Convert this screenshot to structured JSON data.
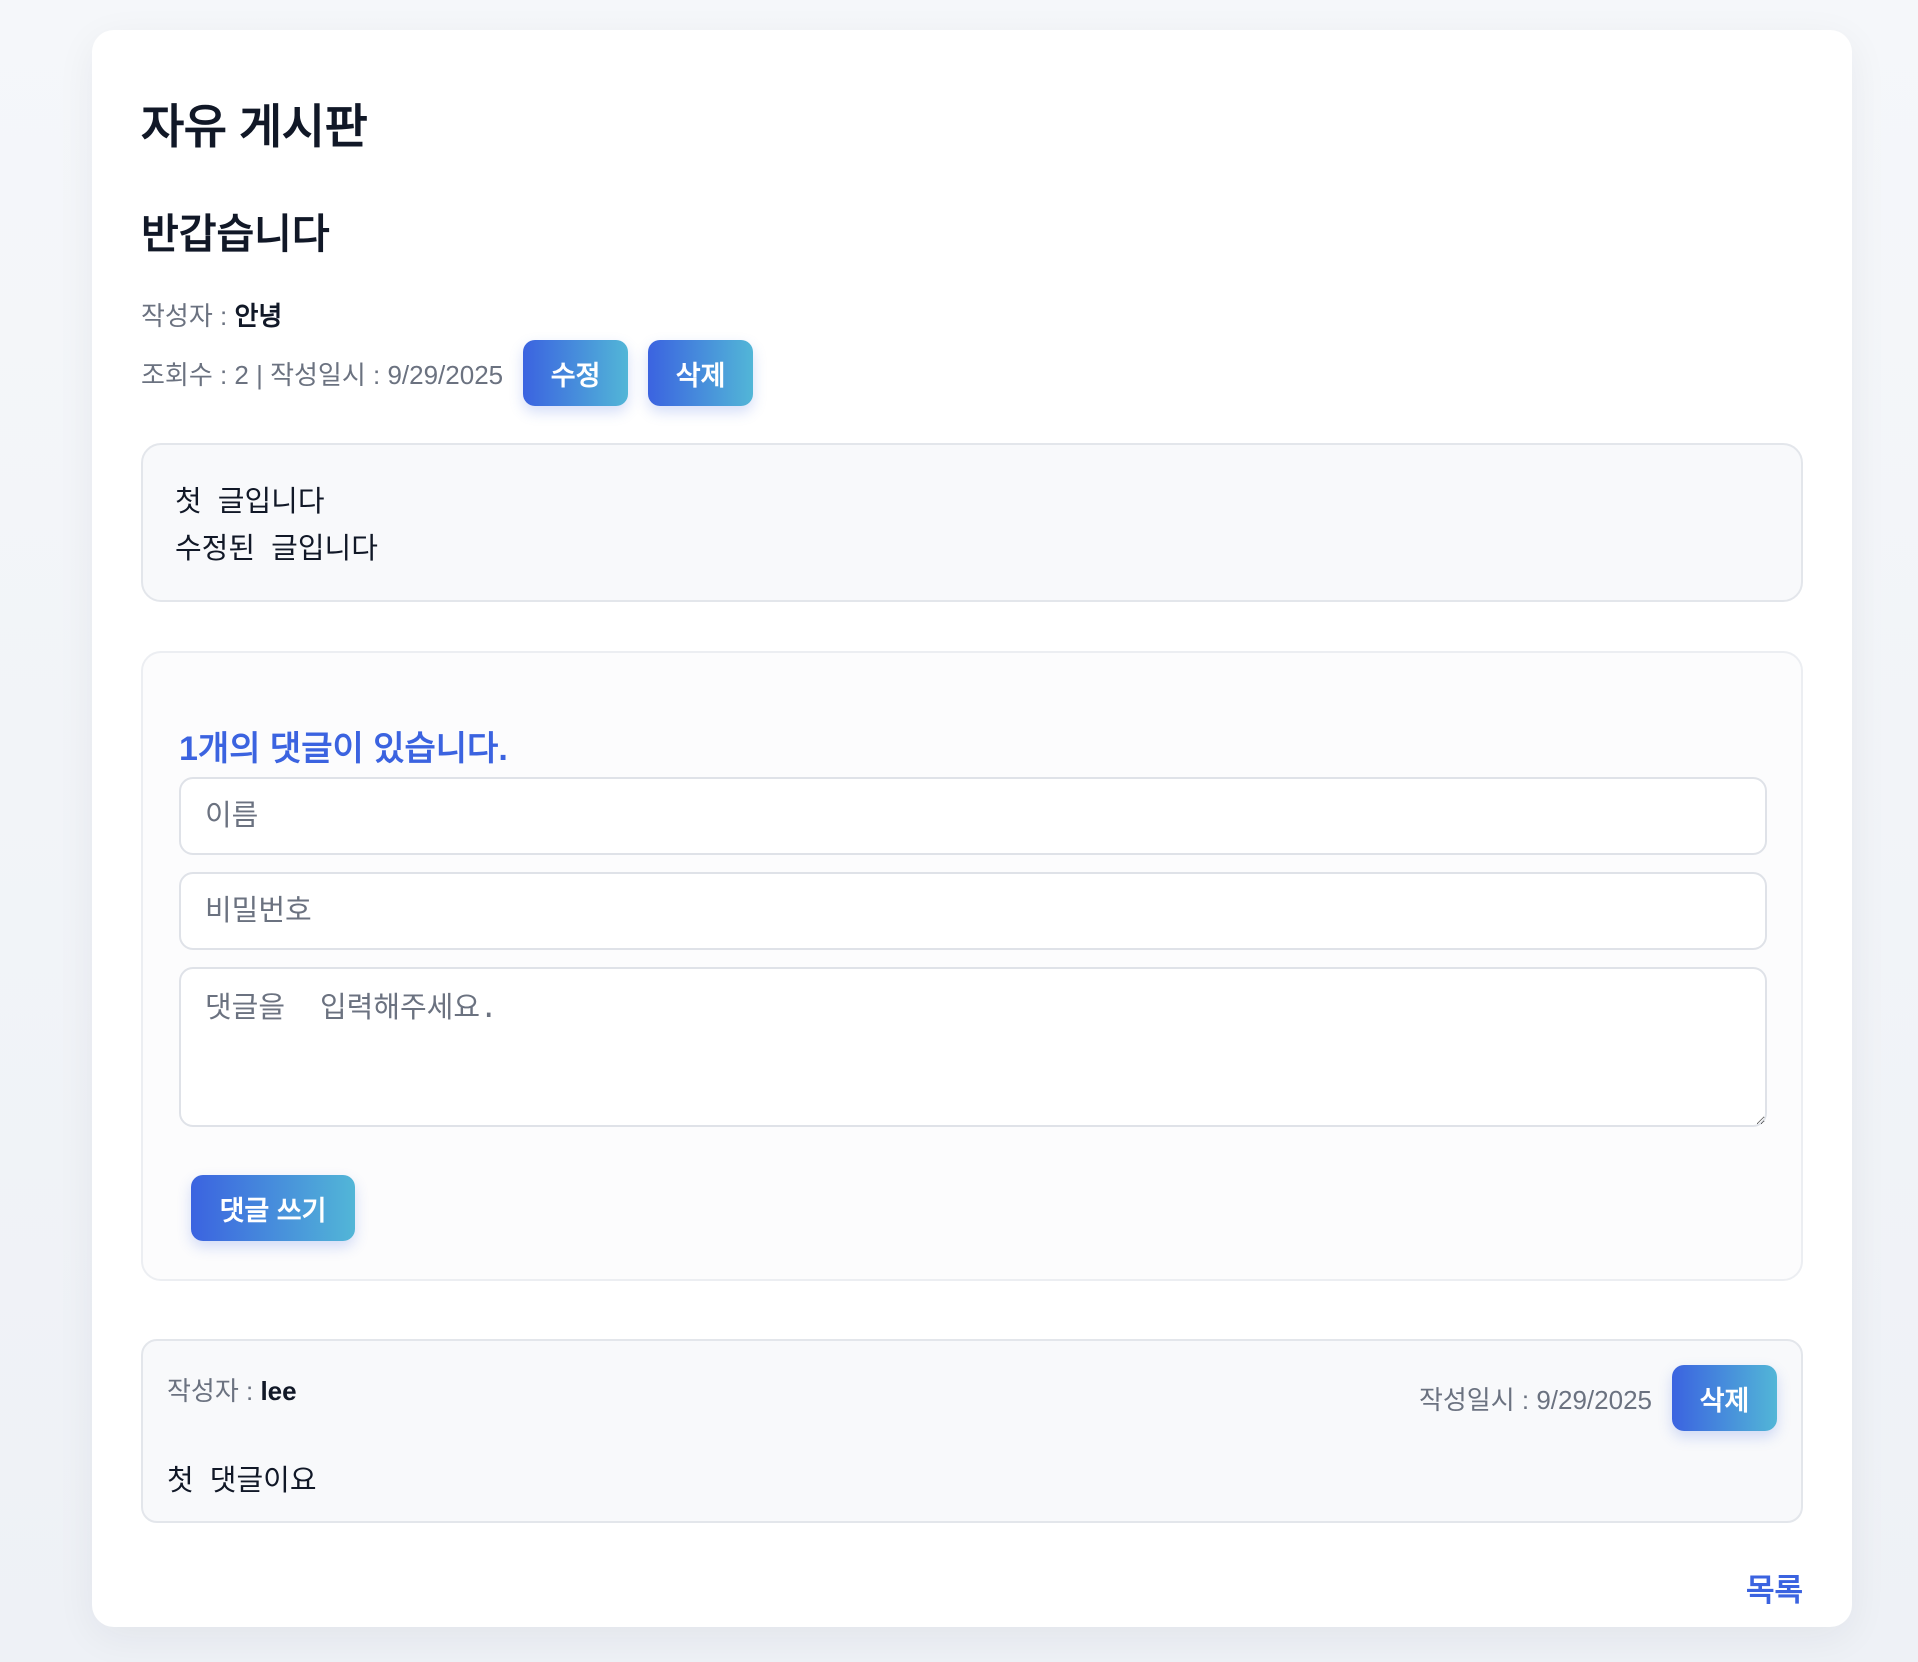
{
  "board": {
    "title": "자유 게시판"
  },
  "post": {
    "title": "반갑습니다",
    "author_label": "작성자 : ",
    "author": "안녕",
    "meta": "조회수 : 2 | 작성일시 : 9/29/2025",
    "edit_label": "수정",
    "delete_label": "삭제",
    "body_lines": [
      "첫  글입니다",
      "수정된  글입니다"
    ]
  },
  "comment_form": {
    "count_text": "1개의 댓글이 있습니다.",
    "name_placeholder": "이름",
    "password_placeholder": "비밀번호",
    "comment_placeholder": "댓글을  입력해주세요.",
    "submit_label": "댓글 쓰기"
  },
  "comments": [
    {
      "author_label": "작성자 : ",
      "author": "lee",
      "date": "작성일시 : 9/29/2025",
      "delete_label": "삭제",
      "body": "첫  댓글이요"
    }
  ],
  "footer": {
    "list_link": "목록"
  },
  "colors": {
    "accent": "#3b63e0",
    "accent_end": "#52b6d7",
    "text": "#111827",
    "muted": "#6b7280"
  }
}
